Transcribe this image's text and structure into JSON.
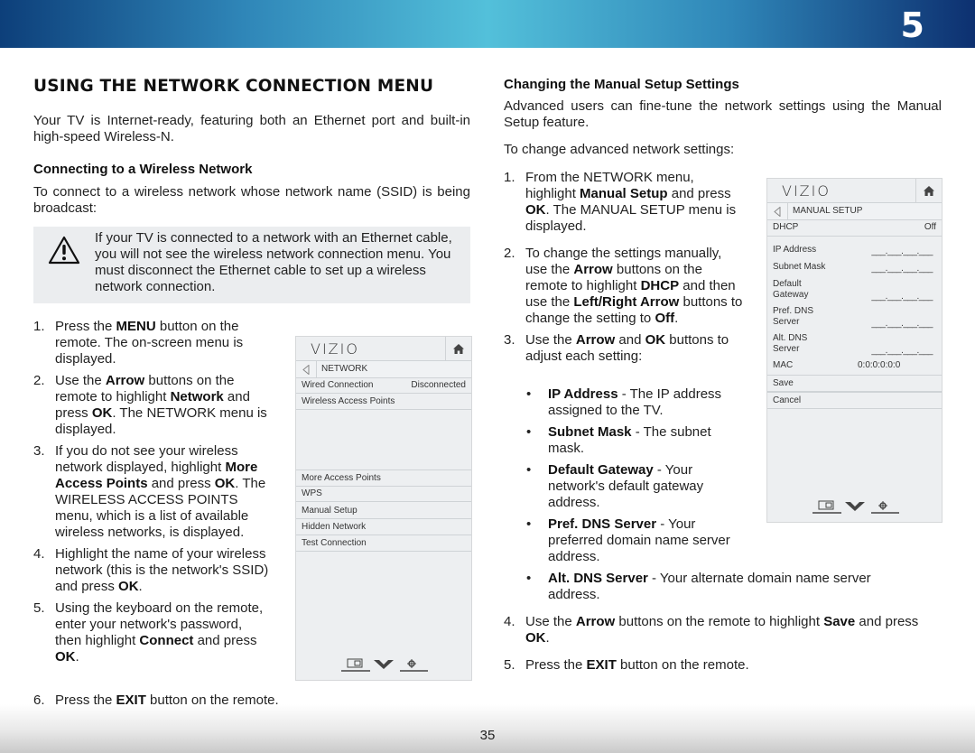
{
  "header": {
    "chapter_number": "5"
  },
  "left": {
    "title": "USING THE NETWORK CONNECTION MENU",
    "intro": "Your TV is Internet-ready, featuring both an Ethernet port and built-in high-speed Wireless-N.",
    "subheading": "Connecting to a Wireless Network",
    "subintro": "To connect to a wireless network whose network name (SSID) is being broadcast:",
    "note": {
      "icon": "warning-icon",
      "text": "If your TV is connected to a network with an Ethernet cable, you will not see the wireless network connection menu. You must disconnect the Ethernet cable to set up a wireless network connection."
    },
    "steps": [
      {
        "num": "1.",
        "parts": [
          [
            "Press the ",
            false
          ],
          [
            "MENU",
            true
          ],
          [
            " button on the remote. The on-screen menu is displayed.",
            false
          ]
        ]
      },
      {
        "num": "2.",
        "parts": [
          [
            "Use the ",
            false
          ],
          [
            "Arrow",
            true
          ],
          [
            " buttons on the remote to highlight ",
            false
          ],
          [
            "Network",
            true
          ],
          [
            " and press ",
            false
          ],
          [
            "OK",
            true
          ],
          [
            ". The NETWORK menu is displayed.",
            false
          ]
        ]
      },
      {
        "num": "3.",
        "parts": [
          [
            "If you do not see your wireless network displayed, highlight ",
            false
          ],
          [
            "More Access Points",
            true
          ],
          [
            " and press ",
            false
          ],
          [
            "OK",
            true
          ],
          [
            ". The WIRELESS ACCESS POINTS menu, which is a list of available wireless networks, is displayed.",
            false
          ]
        ]
      },
      {
        "num": "4.",
        "parts": [
          [
            "Highlight the name of your wireless network (this is the network's SSID) and press ",
            false
          ],
          [
            "OK",
            true
          ],
          [
            ".",
            false
          ]
        ]
      },
      {
        "num": "5.",
        "parts": [
          [
            "Using the keyboard on the remote, enter your network's password, then highlight ",
            false
          ],
          [
            "Connect",
            true
          ],
          [
            " and press ",
            false
          ],
          [
            "OK",
            true
          ],
          [
            ".",
            false
          ]
        ]
      }
    ],
    "step6": {
      "num": "6.",
      "parts": [
        [
          "Press the ",
          false
        ],
        [
          "EXIT",
          true
        ],
        [
          " button on the remote.",
          false
        ]
      ]
    }
  },
  "network_menu": {
    "logo": "VIZIO",
    "breadcrumb": "NETWORK",
    "wired_label": "Wired Connection",
    "wired_value": "Disconnected",
    "wireless_label": "Wireless Access Points",
    "items": [
      "More Access Points",
      "WPS",
      "Manual Setup",
      "Hidden Network",
      "Test Connection"
    ],
    "icons": [
      "input-icon",
      "vizio-v-icon",
      "settings-gear-icon"
    ]
  },
  "right": {
    "subheading": "Changing the Manual Setup Settings",
    "intro": "Advanced users can fine-tune the network settings using the Manual Setup feature.",
    "lead": "To change advanced network settings:",
    "steps": [
      {
        "num": "1.",
        "parts": [
          [
            "From the NETWORK menu, highlight ",
            false
          ],
          [
            "Manual Setup",
            true
          ],
          [
            " and press ",
            false
          ],
          [
            "OK",
            true
          ],
          [
            ". The MANUAL SETUP menu is displayed.",
            false
          ]
        ]
      },
      {
        "num": "2.",
        "parts": [
          [
            "To change the settings manually, use the ",
            false
          ],
          [
            "Arrow",
            true
          ],
          [
            " buttons on the remote to highlight ",
            false
          ],
          [
            "DHCP",
            true
          ],
          [
            " and then use the ",
            false
          ],
          [
            "Left/Right Arrow",
            true
          ],
          [
            " buttons to change the setting to ",
            false
          ],
          [
            "Off",
            true
          ],
          [
            ".",
            false
          ]
        ]
      },
      {
        "num": "3.",
        "parts": [
          [
            "Use the ",
            false
          ],
          [
            "Arrow",
            true
          ],
          [
            " and ",
            false
          ],
          [
            "OK",
            true
          ],
          [
            " buttons to adjust each setting:",
            false
          ]
        ]
      }
    ],
    "bullets": [
      {
        "parts": [
          [
            "IP Address",
            true
          ],
          [
            " - The IP address assigned to the TV.",
            false
          ]
        ]
      },
      {
        "parts": [
          [
            "Subnet Mask",
            true
          ],
          [
            " - The subnet mask.",
            false
          ]
        ]
      },
      {
        "parts": [
          [
            "Default Gateway",
            true
          ],
          [
            " - Your network's default gateway address.",
            false
          ]
        ]
      },
      {
        "parts": [
          [
            "Pref. DNS Server",
            true
          ],
          [
            " - Your preferred domain name server address.",
            false
          ]
        ]
      }
    ],
    "bullet_alt": {
      "parts": [
        [
          "Alt. DNS Server",
          true
        ],
        [
          " - Your alternate domain name server address.",
          false
        ]
      ]
    },
    "steps_after": [
      {
        "num": "4.",
        "parts": [
          [
            "Use the ",
            false
          ],
          [
            "Arrow",
            true
          ],
          [
            " buttons on the remote to highlight ",
            false
          ],
          [
            "Save",
            true
          ],
          [
            " and press ",
            false
          ],
          [
            "OK",
            true
          ],
          [
            ".",
            false
          ]
        ]
      },
      {
        "num": "5.",
        "parts": [
          [
            "Press the ",
            false
          ],
          [
            "EXIT",
            true
          ],
          [
            " button on the remote.",
            false
          ]
        ]
      }
    ]
  },
  "manual_menu": {
    "logo": "VIZIO",
    "breadcrumb": "MANUAL SETUP",
    "dhcp_label": "DHCP",
    "dhcp_value": "Off",
    "fields": [
      {
        "label": "IP Address",
        "value": "___.___.___.___"
      },
      {
        "label": "Subnet Mask",
        "value": "___.___.___.___"
      },
      {
        "label": "Default Gateway",
        "value": "___.___.___.___"
      },
      {
        "label": "Pref. DNS Server",
        "value": "___.___.___.___"
      },
      {
        "label": "Alt. DNS Server",
        "value": "___.___.___.___"
      }
    ],
    "mac_label": "MAC",
    "mac_value": "0:0:0:0:0:0",
    "save_label": "Save",
    "cancel_label": "Cancel",
    "icons": [
      "input-icon",
      "vizio-v-icon",
      "settings-gear-icon"
    ]
  },
  "footer": {
    "page_number": "35"
  }
}
